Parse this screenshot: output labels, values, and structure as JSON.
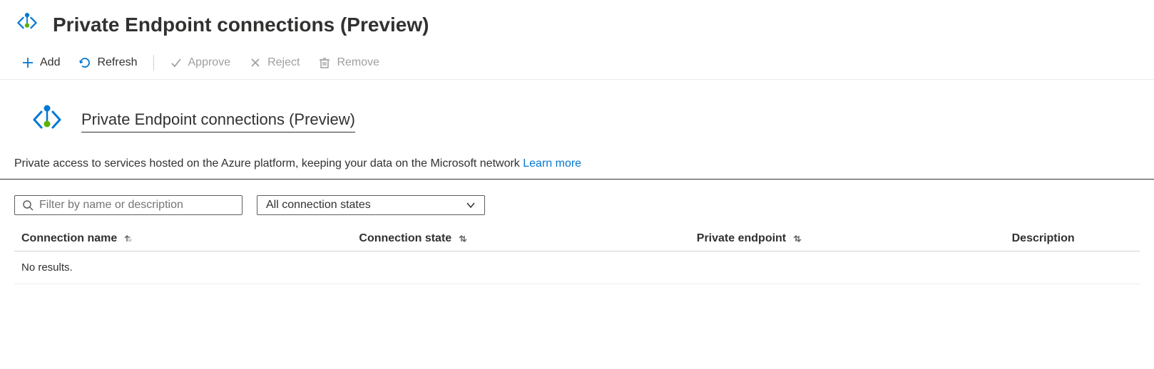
{
  "header": {
    "title": "Private Endpoint connections (Preview)"
  },
  "toolbar": {
    "add": "Add",
    "refresh": "Refresh",
    "approve": "Approve",
    "reject": "Reject",
    "remove": "Remove"
  },
  "subheader": {
    "title": "Private Endpoint connections (Preview)"
  },
  "description": {
    "text": "Private access to services hosted on the Azure platform, keeping your data on the Microsoft network ",
    "link": "Learn more"
  },
  "filters": {
    "search_placeholder": "Filter by name or description",
    "state_select": "All connection states"
  },
  "table": {
    "columns": {
      "name": "Connection name",
      "state": "Connection state",
      "endpoint": "Private endpoint",
      "description": "Description"
    },
    "empty": "No results."
  }
}
